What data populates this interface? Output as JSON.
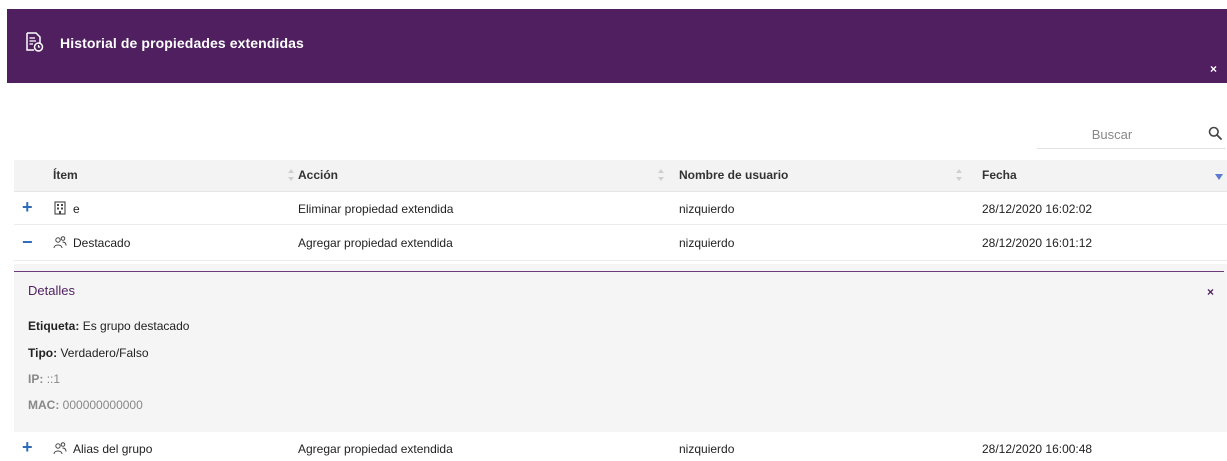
{
  "header": {
    "title": "Historial de propiedades extendidas",
    "close": "×",
    "bg_color": "#4f1f5f",
    "icon": "document-history-icon"
  },
  "search": {
    "placeholder": "Buscar",
    "icon": "search-icon"
  },
  "table": {
    "columns": [
      "Ítem",
      "Acción",
      "Nombre de usuario",
      "Fecha"
    ],
    "sorted_column": "Fecha",
    "sort_direction": "desc",
    "rows": [
      {
        "expander": "+",
        "icon": "building-icon",
        "item": "e",
        "accion": "Eliminar propiedad extendida",
        "usuario": "nizquierdo",
        "fecha": "28/12/2020 16:02:02"
      },
      {
        "expander": "−",
        "icon": "user-group-icon",
        "item": "Destacado",
        "accion": "Agregar propiedad extendida",
        "usuario": "nizquierdo",
        "fecha": "28/12/2020 16:01:12"
      },
      {
        "expander": "+",
        "icon": "user-group-icon",
        "item": "Alias del grupo",
        "accion": "Agregar propiedad extendida",
        "usuario": "nizquierdo",
        "fecha": "28/12/2020 16:00:48"
      }
    ]
  },
  "details": {
    "title": "Detalles",
    "close": "×",
    "etiqueta_label": "Etiqueta:",
    "etiqueta_value": "Es grupo destacado",
    "tipo_label": "Tipo:",
    "tipo_value": "Verdadero/Falso",
    "ip_label": "IP:",
    "ip_value": "::1",
    "mac_label": "MAC:",
    "mac_value": "000000000000"
  }
}
